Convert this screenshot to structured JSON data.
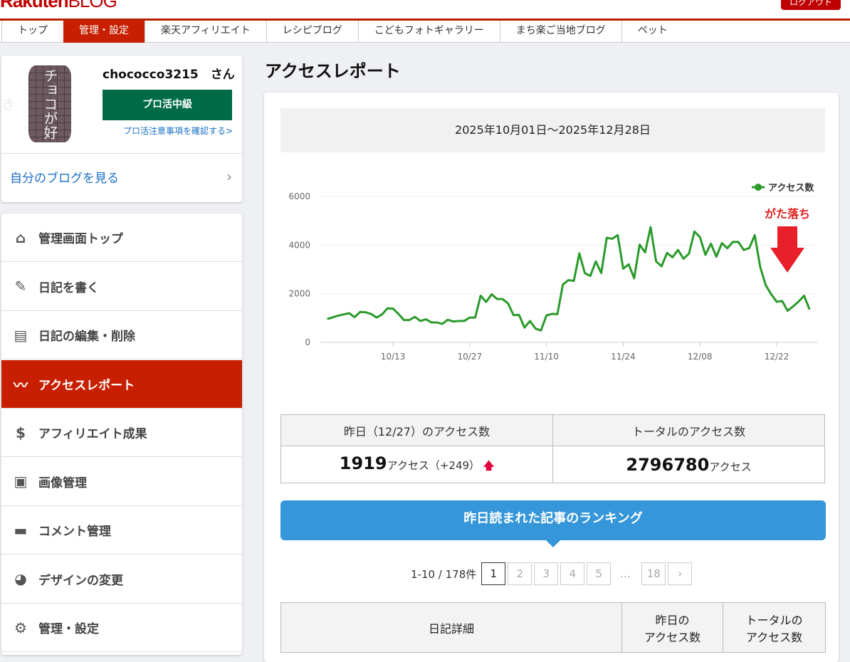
{
  "header": {
    "logo": "Rakuten BLOG",
    "logout": "ログアウト"
  },
  "nav": [
    "トップ",
    "管理・設定",
    "楽天アフィリエイト",
    "レシピブログ",
    "こどもフォトギャラリー",
    "まち楽ご当地ブログ",
    "ペット"
  ],
  "profile": {
    "avatar_text": "チョコが好き",
    "username": "chococco3215　さん",
    "pro_label": "プロ活中級",
    "pro_notice": "プロ活注意事項を確認する>",
    "my_blog": "自分のブログを見る"
  },
  "menu": [
    {
      "label": "管理画面トップ",
      "icon": "home-icon"
    },
    {
      "label": "日記を書く",
      "icon": "pencil-icon"
    },
    {
      "label": "日記の編集・削除",
      "icon": "document-icon"
    },
    {
      "label": "アクセスレポート",
      "icon": "trend-icon"
    },
    {
      "label": "アフィリエイト成果",
      "icon": "money-bag-icon"
    },
    {
      "label": "画像管理",
      "icon": "image-icon"
    },
    {
      "label": "コメント管理",
      "icon": "comment-icon"
    },
    {
      "label": "デザインの変更",
      "icon": "palette-icon"
    },
    {
      "label": "管理・設定",
      "icon": "gear-icon"
    }
  ],
  "page_title": "アクセスレポート",
  "date_range": "2025年10月01日〜2025年12月28日",
  "chart_data": {
    "type": "line",
    "legend": "アクセス数",
    "legend_position": "top-right",
    "annotation": "がた落ち",
    "ylim": [
      0,
      6000
    ],
    "yticks": [
      "0",
      "2000",
      "4000",
      "6000"
    ],
    "xticks": [
      {
        "label": "10/13",
        "day": 12
      },
      {
        "label": "10/27",
        "day": 26
      },
      {
        "label": "11/10",
        "day": 40
      },
      {
        "label": "11/24",
        "day": 54
      },
      {
        "label": "12/08",
        "day": 68
      },
      {
        "label": "12/22",
        "day": 82
      }
    ],
    "start_date": "10/01",
    "values": [
      960,
      1030,
      1100,
      1150,
      1200,
      1040,
      1250,
      1240,
      1170,
      1020,
      1150,
      1400,
      1390,
      1170,
      920,
      920,
      1050,
      880,
      950,
      820,
      820,
      760,
      930,
      860,
      880,
      880,
      1020,
      1020,
      1920,
      1660,
      1980,
      1780,
      1780,
      1600,
      1120,
      1130,
      610,
      880,
      570,
      490,
      1110,
      1170,
      1160,
      2380,
      2560,
      2530,
      3660,
      2850,
      2730,
      3330,
      2850,
      4300,
      4260,
      4410,
      3030,
      3210,
      2640,
      4020,
      3700,
      4740,
      3330,
      3130,
      3680,
      3500,
      3800,
      3440,
      3650,
      4560,
      4330,
      3600,
      4060,
      3520,
      4080,
      3870,
      4130,
      4130,
      3800,
      3880,
      4410,
      3100,
      2350,
      1980,
      1670,
      1700,
      1300,
      1480,
      1680,
      1919,
      1350
    ],
    "color": "#2a9a2a"
  },
  "stats": {
    "yesterday_header": "昨日（12/27）のアクセス数",
    "total_header": "トータルのアクセス数",
    "yesterday_value": "1919",
    "unit": "アクセス",
    "diff": "（+249）",
    "total_value": "2796780"
  },
  "ranking_title": "昨日読まれた記事のランキング",
  "pager": {
    "count": "1-10 / 178件",
    "pages": [
      "1",
      "2",
      "3",
      "4",
      "5"
    ],
    "dots": "…",
    "last": "18",
    "next": "›"
  },
  "table_headers": [
    "日記詳細",
    "昨日の\nアクセス数",
    "トータルの\nアクセス数"
  ]
}
